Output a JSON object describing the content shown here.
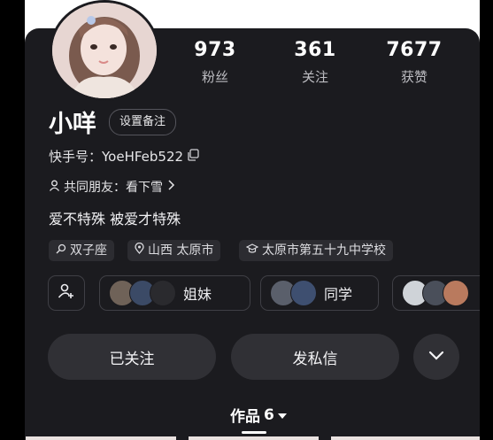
{
  "profile": {
    "name": "小咩",
    "remark_button": "设置备注",
    "kuaishou_id": "快手号：YoeHFeb522",
    "mutual_friends": "共同朋友：看下雪",
    "bio": "爱不特殊 被爱才特殊"
  },
  "stats": [
    {
      "value": "973",
      "label": "粉丝"
    },
    {
      "value": "361",
      "label": "关注"
    },
    {
      "value": "7677",
      "label": "获赞"
    }
  ],
  "tags": [
    {
      "icon": "search-icon",
      "label": "双子座"
    },
    {
      "icon": "location-pin-icon",
      "label": "山西 太原市"
    },
    {
      "icon": "graduation-cap-icon",
      "label": "太原市第五十九中学校"
    }
  ],
  "relations": [
    {
      "label": "姐妹"
    },
    {
      "label": "同学"
    }
  ],
  "actions": {
    "followed": "已关注",
    "message": "发私信"
  },
  "works_tab": {
    "label": "作品",
    "count": "6"
  },
  "colors": {
    "background": "#000000",
    "card": "#1b1b1f",
    "button": "#303035",
    "chip": "#2c2c31"
  }
}
